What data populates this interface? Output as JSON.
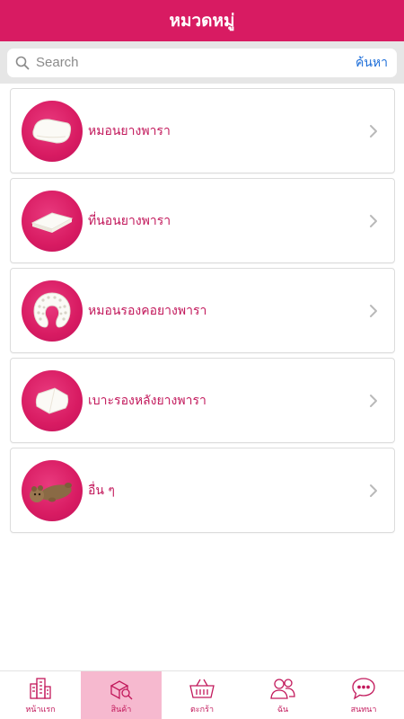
{
  "header": {
    "title": "หมวดหมู่"
  },
  "search": {
    "placeholder": "Search",
    "button_label": "ค้นหา"
  },
  "categories": [
    {
      "label": "หมอนยางพารา",
      "icon": "pillow-icon"
    },
    {
      "label": "ที่นอนยางพารา",
      "icon": "mattress-icon"
    },
    {
      "label": "หมอนรองคอยางพารา",
      "icon": "neck-pillow-icon"
    },
    {
      "label": "เบาะรองหลังยางพารา",
      "icon": "back-cushion-icon"
    },
    {
      "label": "อื่น ๆ",
      "icon": "plush-toy-icon"
    }
  ],
  "tabs": [
    {
      "label": "หน้าแรก",
      "icon": "building-icon",
      "active": false
    },
    {
      "label": "สินค้า",
      "icon": "product-search-icon",
      "active": true
    },
    {
      "label": "ตะกร้า",
      "icon": "basket-icon",
      "active": false
    },
    {
      "label": "ฉัน",
      "icon": "user-icon",
      "active": false
    },
    {
      "label": "สนทนา",
      "icon": "chat-icon",
      "active": false
    }
  ],
  "colors": {
    "brand": "#d81b62",
    "label": "#c2185b",
    "link": "#1e6fd9",
    "active_tab": "#f6b9cf"
  }
}
